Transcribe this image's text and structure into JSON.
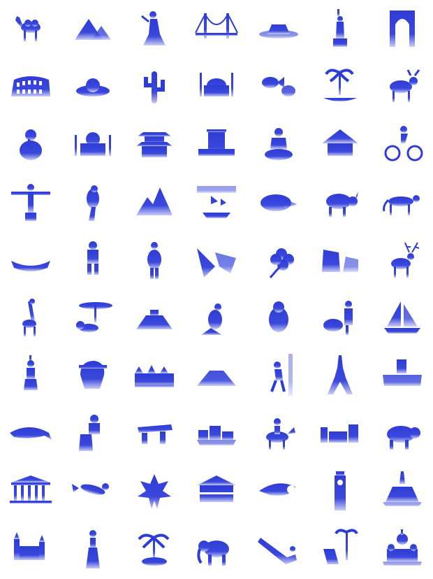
{
  "colors": {
    "primary": "#2e3cd6",
    "dark": "#1a1f9c",
    "light": "#c9cdf5"
  },
  "icons": [
    "camel-icon",
    "pyramids-icon",
    "flamenco-dancer-icon",
    "golden-gate-bridge-icon",
    "mesa-icon",
    "statue-of-liberty-icon",
    "moorish-door-icon",
    "colosseum-icon",
    "sombrero-icon",
    "cactus-icon",
    "hagia-sophia-icon",
    "tropical-fish-icon",
    "palm-canoe-icon",
    "moose-icon",
    "ganesha-icon",
    "taj-mahal-icon",
    "pagoda-icon",
    "belem-tower-icon",
    "buddha-icon",
    "hut-icon",
    "cyclist-icon",
    "christ-redeemer-icon",
    "parrot-icon",
    "machu-picchu-icon",
    "junk-ship-icon",
    "island-coast-icon",
    "rhinoceros-icon",
    "cheetah-icon",
    "canoe-icon",
    "lederhosen-man-icon",
    "fertility-statue-icon",
    "fjord-icon",
    "four-leaf-clover-icon",
    "cliffs-icon",
    "reindeer-icon",
    "giraffe-icon",
    "lion-acacia-icon",
    "mayan-pyramid-icon",
    "kangaroo-icon",
    "seal-icon",
    "shepherd-sheep-icon",
    "sailboat-icon",
    "tribal-woman-icon",
    "moor-head-icon",
    "chateau-icon",
    "volcano-icon",
    "climber-icon",
    "eiffel-tower-icon",
    "vineyard-tower-icon",
    "dolphin-icon",
    "potter-icon",
    "dolmen-icon",
    "village-icon",
    "horse-rider-icon",
    "castle-ruins-icon",
    "bear-icon",
    "parthenon-icon",
    "diver-icon",
    "maple-leaf-icon",
    "colonial-house-icon",
    "conch-shell-icon",
    "big-ben-icon",
    "mont-saint-michel-icon",
    "cathedral-icon",
    "woman-dress-icon",
    "palm-island-icon",
    "elephant-icon",
    "hockey-stick-icon",
    "beach-chair-icon",
    "saint-basil-icon"
  ]
}
